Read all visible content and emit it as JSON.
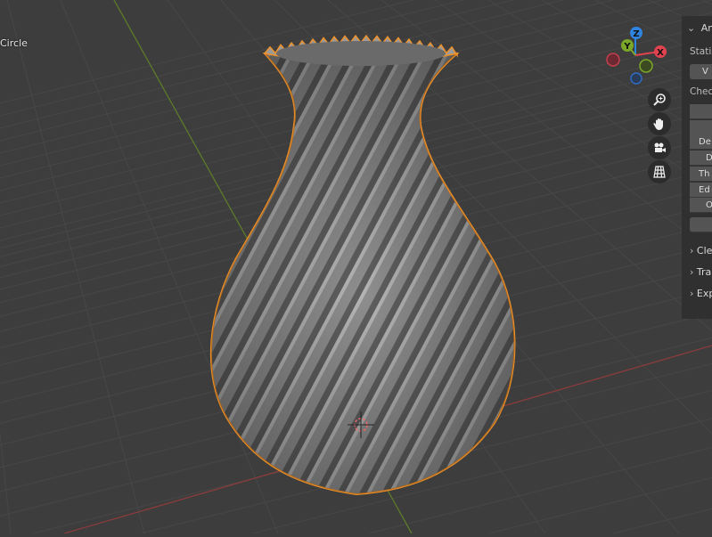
{
  "viewport": {
    "object_name": "Circle",
    "gizmo": {
      "x_label": "X",
      "y_label": "Y",
      "z_label": "Z",
      "colors": {
        "x": "#e0424f",
        "y": "#7ba828",
        "z": "#2f84e0"
      }
    },
    "nav_buttons": [
      "zoom-icon",
      "hand-pan-icon",
      "camera-icon",
      "grid-view-icon"
    ],
    "selection_color": "#f0922a"
  },
  "panel": {
    "header": "Ana",
    "statistics_label": "Statis",
    "statistics_button": "V",
    "checks_label": "Chec",
    "check_buttons": [
      "",
      "",
      "De",
      "D",
      "Th",
      "Ed",
      "O",
      ""
    ],
    "sections": [
      "Cle",
      "Tra",
      "Exp"
    ]
  }
}
